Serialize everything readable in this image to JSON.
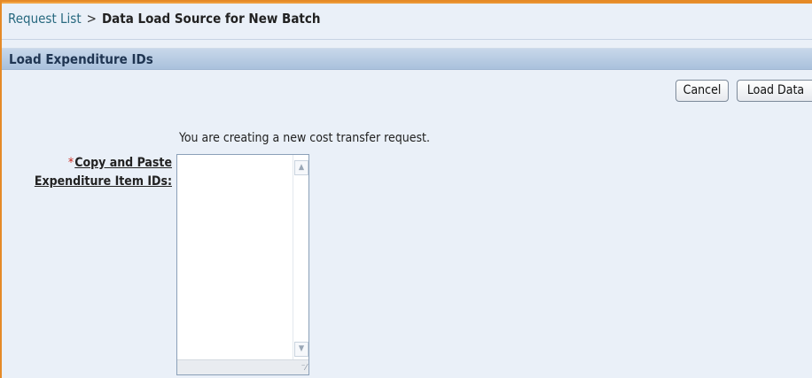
{
  "breadcrumb": {
    "link_label": "Request List",
    "separator": ">",
    "current_label": "Data Load Source for New Batch"
  },
  "section": {
    "title": "Load Expenditure IDs"
  },
  "buttons": {
    "cancel_label": "Cancel",
    "load_data_label": "Load Data"
  },
  "form": {
    "instruction": "You are creating a new cost transfer request.",
    "required_marker": "*",
    "field_label_line1": "Copy and Paste",
    "field_label_line2": "Expenditure Item IDs:",
    "field_value": ""
  },
  "icons": {
    "scroll_up": "scroll-up-arrow-icon",
    "scroll_down": "scroll-down-arrow-icon",
    "resize": "resize-grip-icon"
  },
  "colors": {
    "accent_border": "#e58a27",
    "header_band": "#b8cce3",
    "page_background": "#eaf0f8",
    "link": "#28697f",
    "required": "#c9261b"
  }
}
